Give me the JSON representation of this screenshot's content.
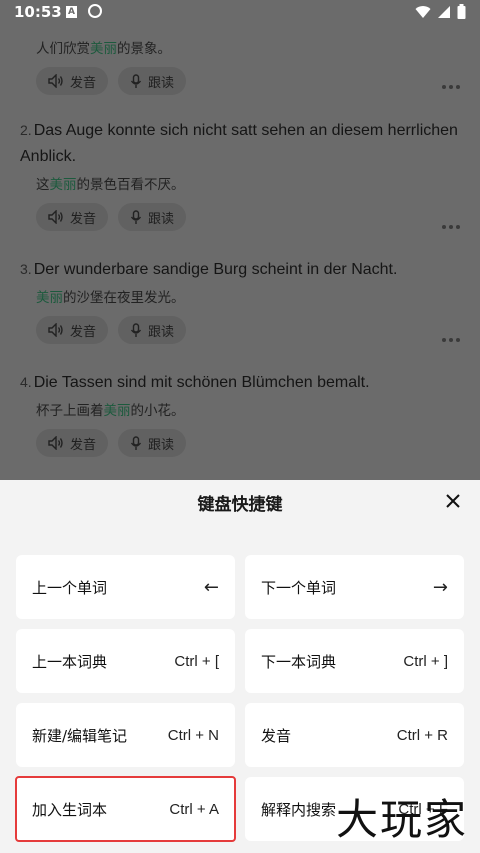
{
  "status_bar": {
    "time": "10:53",
    "icon_a": "A"
  },
  "examples": [
    {
      "number": "",
      "sentence": "",
      "translation_parts": [
        "人们欣赏",
        "美丽",
        "的景象。"
      ],
      "listen_label": "发音",
      "read_label": "跟读"
    },
    {
      "number": "2.",
      "sentence": "Das Auge konnte sich nicht satt sehen an diesem herrlichen Anblick.",
      "translation_parts": [
        "这",
        "美丽",
        "的景色百看不厌。"
      ],
      "listen_label": "发音",
      "read_label": "跟读"
    },
    {
      "number": "3.",
      "sentence": "Der wunderbare sandige Burg scheint in der Nacht.",
      "translation_parts": [
        "",
        "美丽",
        "的沙堡在夜里发光。"
      ],
      "listen_label": "发音",
      "read_label": "跟读"
    },
    {
      "number": "4.",
      "sentence": "Die Tassen sind mit schönen Blümchen bemalt.",
      "translation_parts": [
        "杯子上画着",
        "美丽",
        "的小花。"
      ],
      "listen_label": "发音",
      "read_label": "跟读"
    }
  ],
  "sheet": {
    "title": "键盘快捷键",
    "shortcuts": [
      {
        "label": "上一个单词",
        "key": "←"
      },
      {
        "label": "下一个单词",
        "key": "→"
      },
      {
        "label": "上一本词典",
        "key": "Ctrl + ["
      },
      {
        "label": "下一本词典",
        "key": "Ctrl + ]"
      },
      {
        "label": "新建/编辑笔记",
        "key": "Ctrl + N"
      },
      {
        "label": "发音",
        "key": "Ctrl + R"
      },
      {
        "label": "加入生词本",
        "key": "Ctrl + A"
      },
      {
        "label": "解释内搜索",
        "key": "Ctrl + F"
      }
    ]
  },
  "watermark": "大玩家",
  "colors": {
    "highlight": "#1c5a3d",
    "selected_border": "#e53b3b",
    "overlay": "#6b6b6b"
  }
}
